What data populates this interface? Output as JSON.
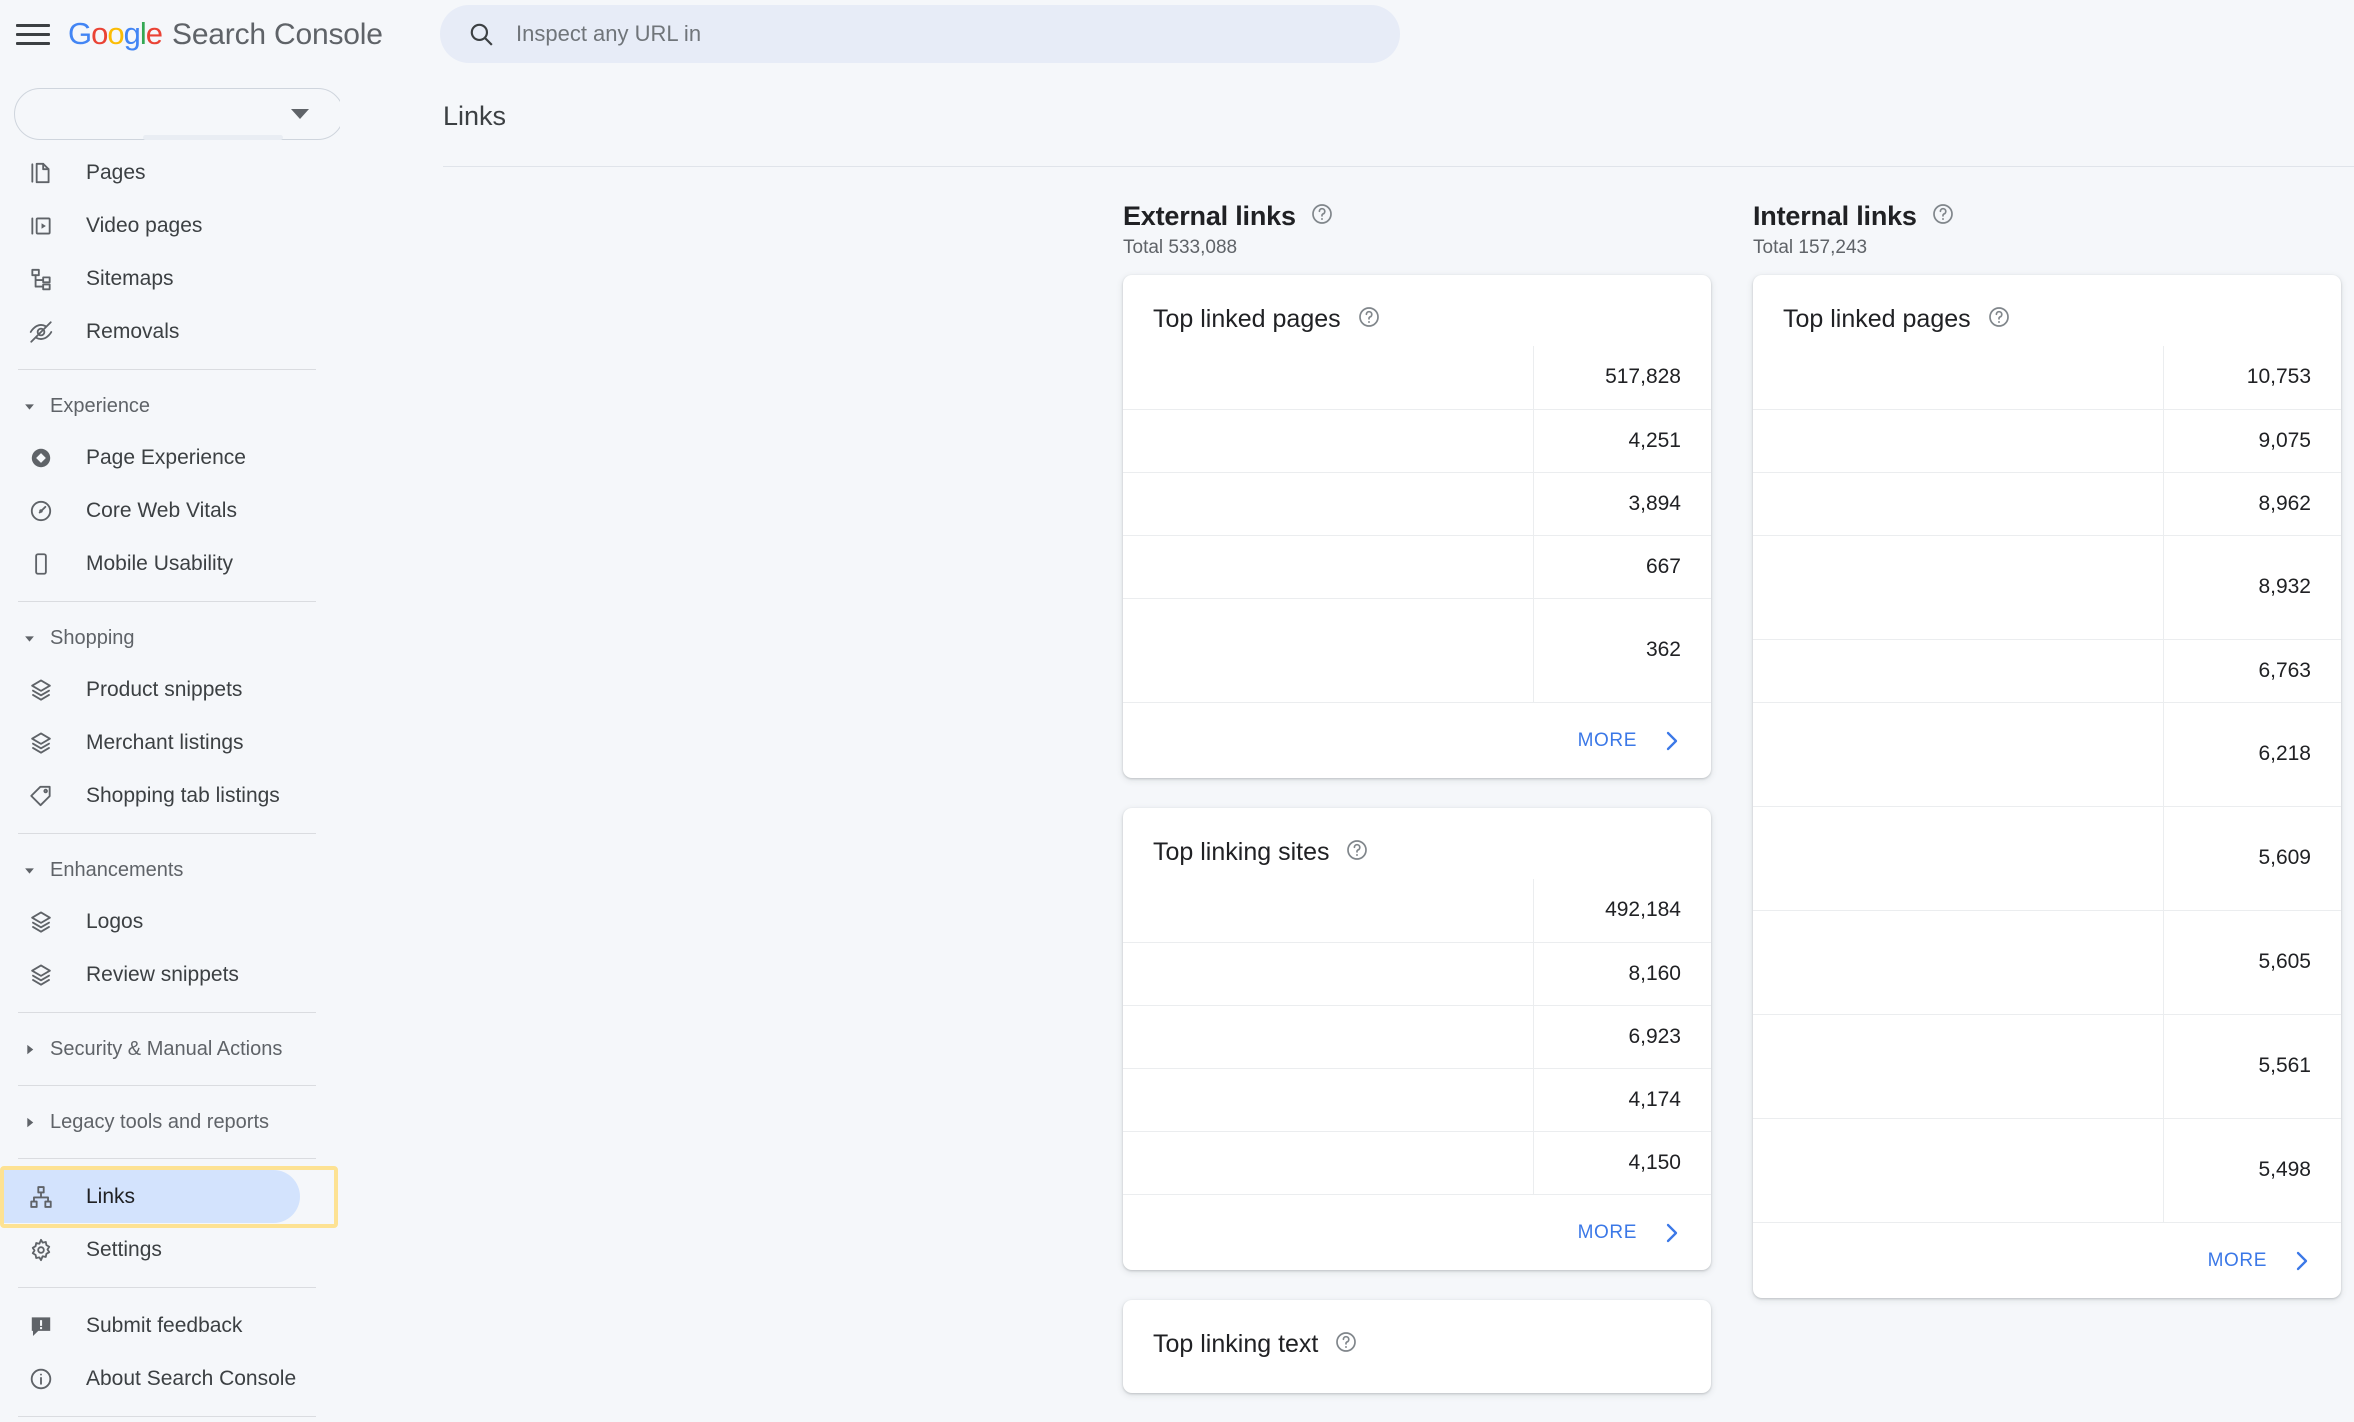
{
  "app": {
    "brand_google": "Google",
    "brand_name": "Search Console",
    "menu_icon": "hamburger-icon"
  },
  "search": {
    "placeholder": "Inspect any URL in",
    "value": "",
    "icon": "search-icon"
  },
  "property_selector": {
    "value": "",
    "icon": "chevron-down-icon"
  },
  "sidebar": {
    "items": [
      {
        "type": "item",
        "label": "Pages",
        "icon": "pages-icon"
      },
      {
        "type": "item",
        "label": "Video pages",
        "icon": "video-pages-icon"
      },
      {
        "type": "item",
        "label": "Sitemaps",
        "icon": "sitemaps-icon"
      },
      {
        "type": "item",
        "label": "Removals",
        "icon": "eye-off-icon"
      },
      {
        "type": "divider"
      },
      {
        "type": "group",
        "label": "Experience",
        "icon": "triangle-down-icon"
      },
      {
        "type": "item",
        "label": "Page Experience",
        "icon": "page-experience-icon"
      },
      {
        "type": "item",
        "label": "Core Web Vitals",
        "icon": "speedometer-icon"
      },
      {
        "type": "item",
        "label": "Mobile Usability",
        "icon": "mobile-icon"
      },
      {
        "type": "divider"
      },
      {
        "type": "group",
        "label": "Shopping",
        "icon": "triangle-down-icon"
      },
      {
        "type": "item",
        "label": "Product snippets",
        "icon": "layers-icon"
      },
      {
        "type": "item",
        "label": "Merchant listings",
        "icon": "layers-icon"
      },
      {
        "type": "item",
        "label": "Shopping tab listings",
        "icon": "tag-icon"
      },
      {
        "type": "divider"
      },
      {
        "type": "group",
        "label": "Enhancements",
        "icon": "triangle-down-icon"
      },
      {
        "type": "item",
        "label": "Logos",
        "icon": "layers-icon"
      },
      {
        "type": "item",
        "label": "Review snippets",
        "icon": "layers-icon"
      },
      {
        "type": "divider"
      },
      {
        "type": "group",
        "label": "Security & Manual Actions",
        "icon": "triangle-right-icon"
      },
      {
        "type": "divider"
      },
      {
        "type": "group",
        "label": "Legacy tools and reports",
        "icon": "triangle-right-icon"
      },
      {
        "type": "divider"
      },
      {
        "type": "item",
        "label": "Links",
        "icon": "links-icon",
        "active": true,
        "focused": true
      },
      {
        "type": "item",
        "label": "Settings",
        "icon": "gear-icon"
      },
      {
        "type": "divider"
      },
      {
        "type": "item",
        "label": "Submit feedback",
        "icon": "feedback-icon"
      },
      {
        "type": "item",
        "label": "About Search Console",
        "icon": "info-icon"
      },
      {
        "type": "divider"
      }
    ]
  },
  "main": {
    "page_title": "Links"
  },
  "columns": [
    {
      "title": "External links",
      "help_icon": "help-circle-icon",
      "total_label": "Total 533,088",
      "cards": [
        {
          "title": "Top linked pages",
          "help_icon": "help-circle-icon",
          "more_label": "MORE",
          "more_icon": "chevron-right-icon",
          "rows": [
            {
              "url": "",
              "value": "517,828",
              "tall": false
            },
            {
              "url": "",
              "value": "4,251",
              "tall": false
            },
            {
              "url": "",
              "value": "3,894",
              "tall": false
            },
            {
              "url": "",
              "value": "667",
              "tall": false
            },
            {
              "url": "",
              "value": "362",
              "tall": true
            }
          ]
        },
        {
          "title": "Top linking sites",
          "help_icon": "help-circle-icon",
          "more_label": "MORE",
          "more_icon": "chevron-right-icon",
          "rows": [
            {
              "url": "",
              "value": "492,184",
              "tall": false
            },
            {
              "url": "",
              "value": "8,160",
              "tall": false
            },
            {
              "url": "",
              "value": "6,923",
              "tall": false
            },
            {
              "url": "",
              "value": "4,174",
              "tall": false
            },
            {
              "url": "",
              "value": "4,150",
              "tall": false
            }
          ]
        },
        {
          "title": "Top linking text",
          "help_icon": "help-circle-icon",
          "more_label": "",
          "more_icon": "",
          "rows": []
        }
      ]
    },
    {
      "title": "Internal links",
      "help_icon": "help-circle-icon",
      "total_label": "Total 157,243",
      "cards": [
        {
          "title": "Top linked pages",
          "help_icon": "help-circle-icon",
          "more_label": "MORE",
          "more_icon": "chevron-right-icon",
          "rows": [
            {
              "url": "",
              "value": "10,753",
              "tall": false
            },
            {
              "url": "",
              "value": "9,075",
              "tall": false
            },
            {
              "url": "",
              "value": "8,962",
              "tall": false
            },
            {
              "url": "",
              "value": "8,932",
              "tall": true
            },
            {
              "url": "",
              "value": "6,763",
              "tall": false
            },
            {
              "url": "",
              "value": "6,218",
              "tall": true
            },
            {
              "url": "",
              "value": "5,609",
              "tall": true
            },
            {
              "url": "",
              "value": "5,605",
              "tall": true
            },
            {
              "url": "",
              "value": "5,561",
              "tall": true
            },
            {
              "url": "",
              "value": "5,498",
              "tall": true
            }
          ]
        }
      ]
    }
  ],
  "colors": {
    "page_bg": "#f5f7fa",
    "card_bg": "#ffffff",
    "accent_blue": "#3b78e7",
    "active_pill": "#d3e3fd",
    "focus_yellow": "#fde293",
    "search_bg": "#e7ecf7",
    "text_primary": "#202124",
    "text_secondary": "#5f6368"
  }
}
